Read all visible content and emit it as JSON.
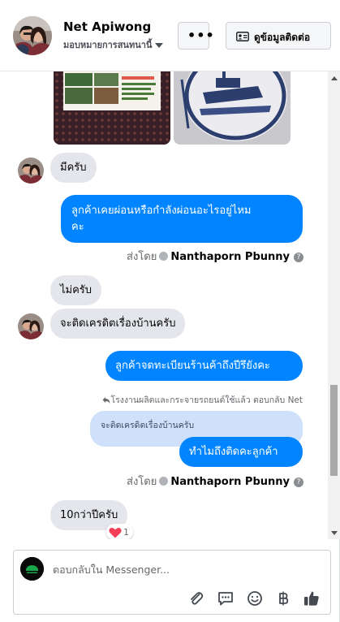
{
  "header": {
    "name": "Net Apiwong",
    "subtitle": "มอบหมายการสนทนานี้",
    "more_label": "•••",
    "contact_label": "ดูข้อมูลติดต่อ"
  },
  "messages": {
    "m1": "มีครับ",
    "m2_line1": "ลูกค้าเคยผ่อนหรือกำลังผ่อนอะไรอยู่ไหม",
    "m2_line2": "คะ",
    "sent_by_1": {
      "prefix": "ส่งโดย",
      "name": "Nanthaporn Pbunny"
    },
    "m3": "ไม่ครับ",
    "m4": "จะติดเครดิตเรื่องบ้านครับ",
    "m5": "ลูกค้าจดทะเบียนร้านค้าถึงปีรึยังคะ",
    "reply_note": "โรงงานผลิตและกระจายรถยนต์ใช้แล้ว ตอบกลับ Net",
    "quoted": "จะติดเครดิตเรื่องบ้านครับ",
    "m6": "ทำไมถึงติดคะลูกค้า",
    "sent_by_2": {
      "prefix": "ส่งโดย",
      "name": "Nanthaporn Pbunny"
    },
    "m7": "10กว่าปีครับ",
    "reaction_count": "1"
  },
  "composer": {
    "placeholder": "ตอบกลับใน Messenger..."
  },
  "icons": [
    "caret-down-icon",
    "contact-card-icon",
    "attach-icon",
    "saved-reply-icon",
    "emoji-icon",
    "baht-icon",
    "like-icon",
    "heart-icon",
    "check-circle-icon",
    "help-icon",
    "reply-arrow-icon"
  ],
  "colors": {
    "accent": "#0084ff",
    "incoming_bubble": "#e4e6eb",
    "quoted_bubble": "#cfe0fb"
  }
}
